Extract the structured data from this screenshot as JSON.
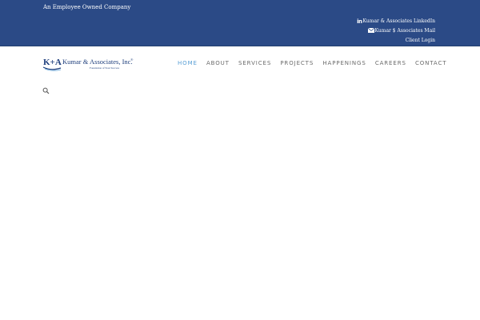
{
  "header": {
    "tagline": "An Employee Owned Company",
    "links": [
      {
        "icon": "linkedin-icon",
        "label": "Kumar & Associates LinkedIn"
      },
      {
        "icon": "envelope-icon",
        "label": "Kumar $ Associates Mail"
      },
      {
        "icon": "",
        "label": "Client Login"
      }
    ],
    "linkedin_glyph": "in"
  },
  "logo": {
    "mark": "K+A",
    "name": "Kumar & Associates, Inc.",
    "registered": "®",
    "slogan": "Foundation of Your Success"
  },
  "nav": {
    "items": [
      "Home",
      "About",
      "Services",
      "Projects",
      "Happenings",
      "Careers",
      "Contact"
    ],
    "active_index": 0
  },
  "search": {
    "icon": "search-icon"
  },
  "colors": {
    "header_bg": "#2b4a86",
    "nav_active": "#5aa0d6",
    "nav_text": "#6b6b6b",
    "logo_blue": "#1f3f7d"
  }
}
